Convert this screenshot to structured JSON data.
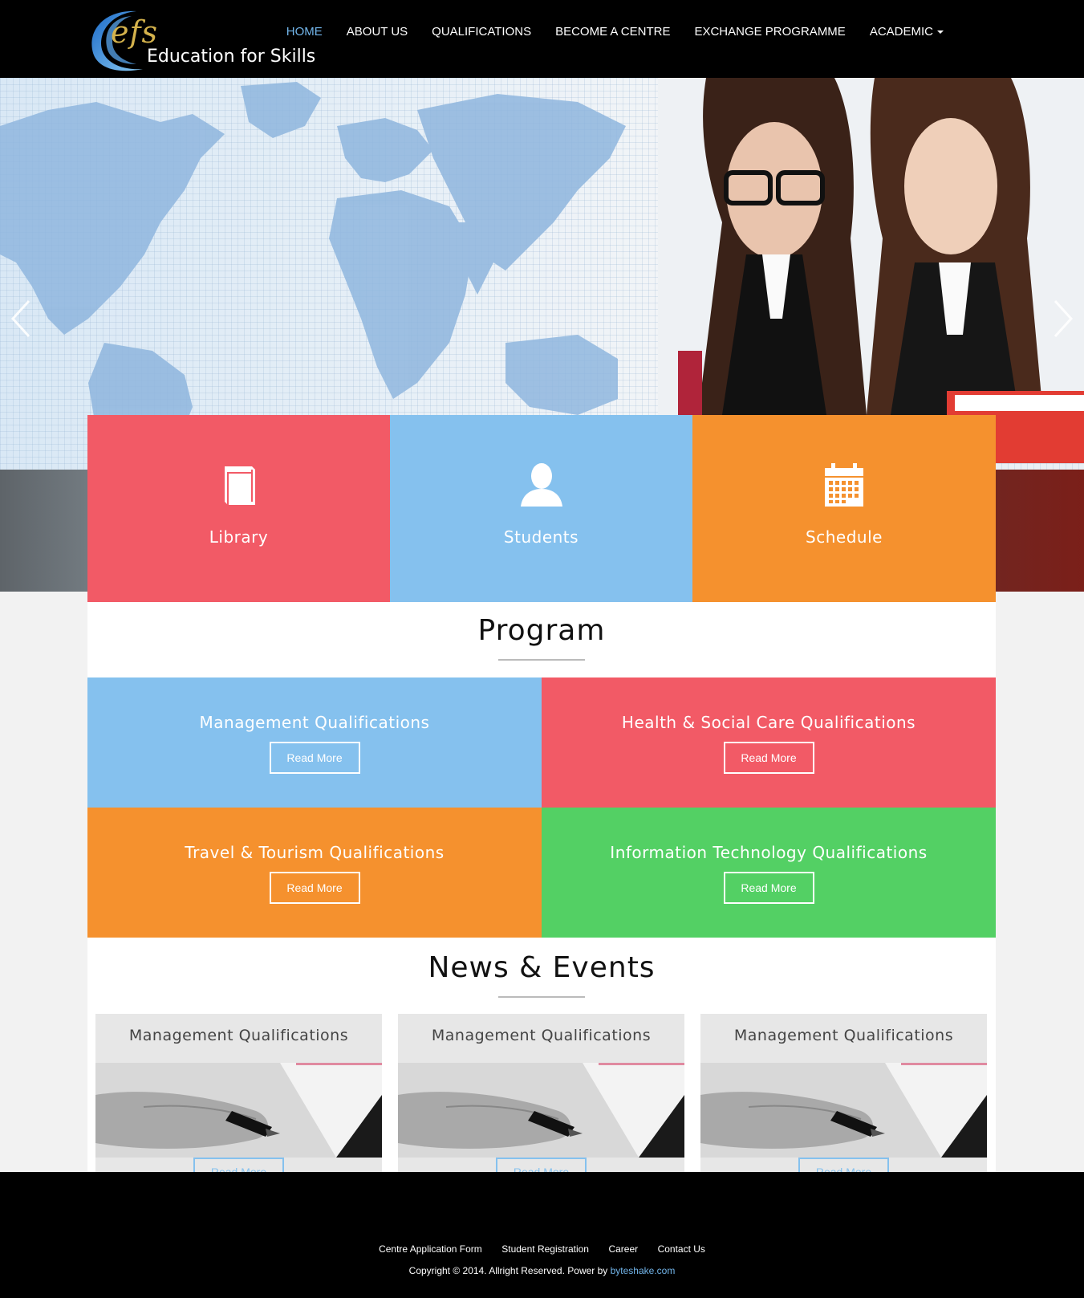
{
  "brand": {
    "logo_mark": "efs",
    "name": "Education for Skills"
  },
  "nav": {
    "items": [
      {
        "label": "HOME",
        "active": true
      },
      {
        "label": "ABOUT US"
      },
      {
        "label": "QUALIFICATIONS"
      },
      {
        "label": "BECOME A CENTRE"
      },
      {
        "label": "EXCHANGE PROGRAMME"
      },
      {
        "label": "ACADEMIC",
        "dropdown": true
      }
    ]
  },
  "hero": {
    "prev_icon": "chevron-left-icon",
    "next_icon": "chevron-right-icon"
  },
  "features": [
    {
      "label": "Library",
      "icon": "book-icon",
      "color": "#f25a66"
    },
    {
      "label": "Students",
      "icon": "user-icon",
      "color": "#85c1ee"
    },
    {
      "label": "Schedule",
      "icon": "calendar-icon",
      "color": "#f5912e"
    }
  ],
  "program": {
    "title": "Program",
    "items": [
      {
        "title": "Management Qualifications",
        "button": "Read More",
        "color": "#85c1ee"
      },
      {
        "title": "Health & Social Care Qualifications",
        "button": "Read More",
        "color": "#f25a66"
      },
      {
        "title": "Travel & Tourism Qualifications",
        "button": "Read More",
        "color": "#f5912e"
      },
      {
        "title": "Information Technology Qualifications",
        "button": "Read More",
        "color": "#53d064"
      }
    ]
  },
  "news": {
    "title": "News & Events",
    "items": [
      {
        "title": "Management Qualifications",
        "button": "Read More"
      },
      {
        "title": "Management Qualifications",
        "button": "Read More"
      },
      {
        "title": "Management Qualifications",
        "button": "Read More"
      }
    ]
  },
  "footer": {
    "links": [
      "Centre Application Form",
      "Student Registration",
      "Career",
      "Contact Us"
    ],
    "copyright": "Copyright © 2014. Allright Reserved. Power by ",
    "powered_by": "byteshake.com"
  },
  "colors": {
    "accent": "#72b5ea",
    "red": "#f25a66",
    "blue": "#85c1ee",
    "orange": "#f5912e",
    "green": "#53d064"
  }
}
